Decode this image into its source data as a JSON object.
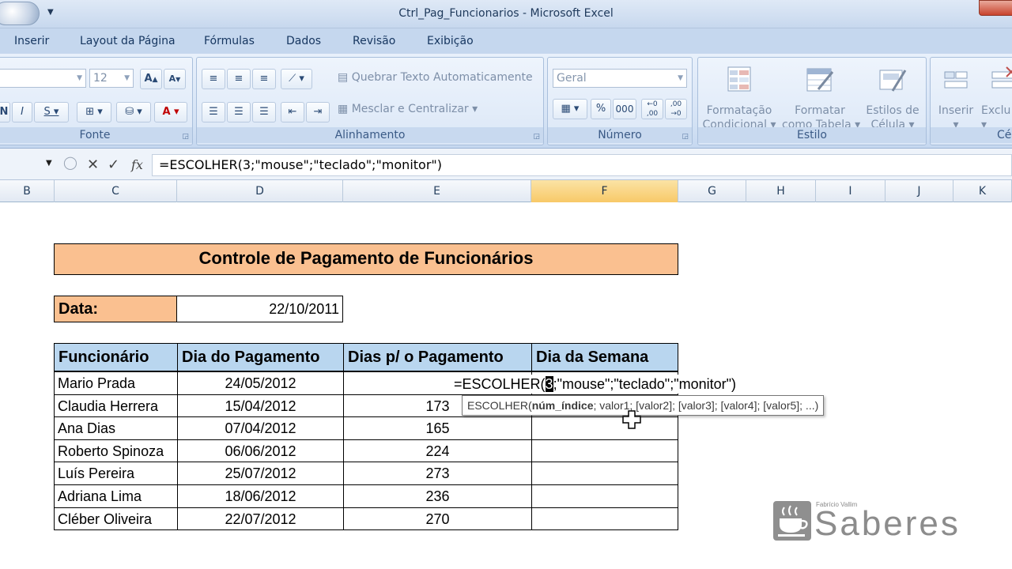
{
  "window": {
    "title": "Ctrl_Pag_Funcionarios - Microsoft Excel"
  },
  "tabs": [
    "Inserir",
    "Layout da Página",
    "Fórmulas",
    "Dados",
    "Revisão",
    "Exibição"
  ],
  "ribbon": {
    "font_group": {
      "label": "Fonte",
      "font_size": "12"
    },
    "alignment_group": {
      "label": "Alinhamento",
      "wrap_text": "Quebrar Texto Automaticamente",
      "merge_center": "Mesclar e Centralizar"
    },
    "number_group": {
      "label": "Número",
      "format": "Geral",
      "percent": "%",
      "thousands": "000"
    },
    "style_group": {
      "label": "Estilo",
      "conditional_line1": "Formatação",
      "conditional_line2": "Condicional",
      "table_line1": "Formatar",
      "table_line2": "como Tabela",
      "cell_styles_line1": "Estilos de",
      "cell_styles_line2": "Célula"
    },
    "cells_group": {
      "label": "Célu",
      "insert": "Inserir",
      "delete": "Exclu"
    }
  },
  "formula_bar": {
    "fx": "fx",
    "formula": "=ESCOLHER(3;\"mouse\";\"teclado\";\"monitor\")"
  },
  "columns": [
    "B",
    "C",
    "D",
    "E",
    "F",
    "G",
    "H",
    "I",
    "J",
    "K"
  ],
  "sheet": {
    "title": "Controle de Pagamento de Funcionários",
    "date_label": "Data:",
    "date_value": "22/10/2011",
    "headers": [
      "Funcionário",
      "Dia do Pagamento",
      "Dias p/ o Pagamento",
      "Dia da Semana"
    ],
    "rows": [
      {
        "name": "Mario Prada",
        "date": "24/05/2012",
        "days": ""
      },
      {
        "name": "Claudia Herrera",
        "date": "15/04/2012",
        "days": "173"
      },
      {
        "name": "Ana Dias",
        "date": "07/04/2012",
        "days": "165"
      },
      {
        "name": "Roberto Spinoza",
        "date": "06/06/2012",
        "days": "224"
      },
      {
        "name": "Luís Pereira",
        "date": "25/07/2012",
        "days": "273"
      },
      {
        "name": "Adriana Lima",
        "date": "18/06/2012",
        "days": "236"
      },
      {
        "name": "Cléber Oliveira",
        "date": "22/07/2012",
        "days": "270"
      }
    ],
    "editing": {
      "before": "=ESCOLHER(",
      "index": "3",
      "after": ";\"mouse\";\"teclado\";\"monitor\")"
    },
    "tooltip": {
      "func": "ESCOLHER(",
      "arg_bold": "núm_índice",
      "rest": "; valor1; [valor2]; [valor3]; [valor4]; [valor5]; ...)"
    }
  },
  "watermark": {
    "author": "Fabrício Vallim",
    "brand": "Saberes"
  }
}
